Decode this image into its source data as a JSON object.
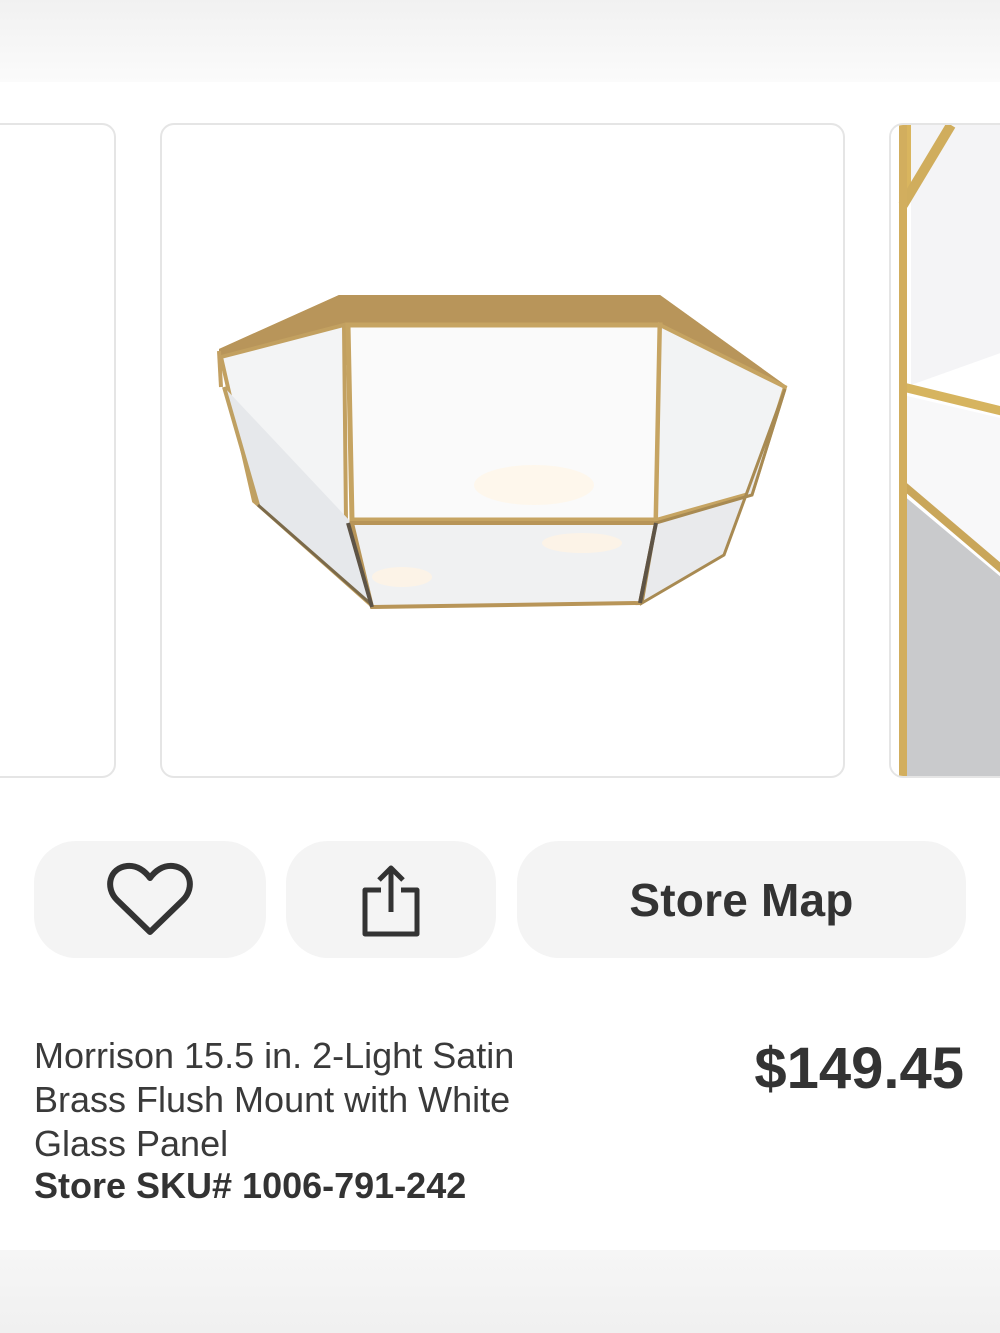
{
  "gallery": {
    "images": [
      {
        "alt": "previous product image",
        "icon": "image-placeholder"
      },
      {
        "alt": "Morrison flush mount light",
        "icon": "ceiling-light"
      },
      {
        "alt": "close-up of glass panel",
        "icon": "image-placeholder"
      }
    ]
  },
  "actions": {
    "favorite_icon": "heart-icon",
    "share_icon": "share-icon",
    "store_map_label": "Store Map"
  },
  "product": {
    "title": "Morrison 15.5 in. 2-Light Satin Brass Flush Mount with White Glass Panel",
    "sku": "Store SKU# 1006-791-242",
    "price": "$149.45"
  },
  "colors": {
    "brass": "#c9a765",
    "text": "#333333",
    "pill_bg": "#f4f4f4",
    "rating_accent": "#f96302"
  }
}
